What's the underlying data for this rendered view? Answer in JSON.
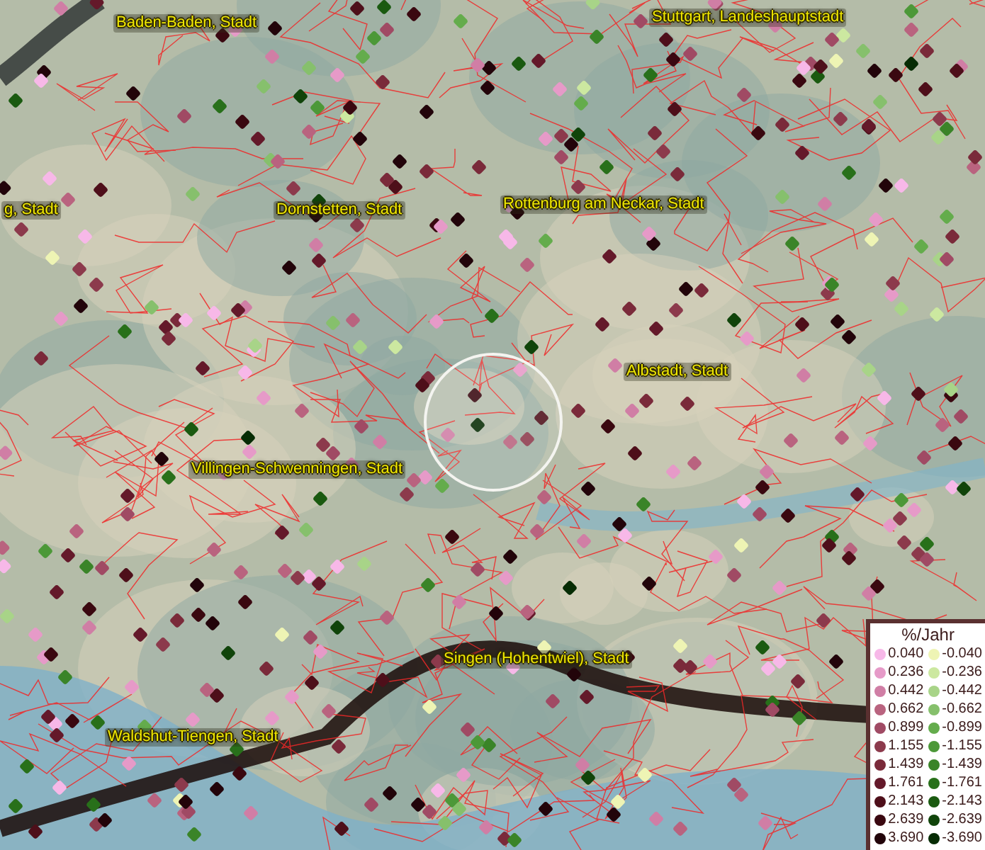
{
  "map": {
    "place_labels": [
      {
        "text": "Baden-Baden, Stadt"
      },
      {
        "text": "Stuttgart, Landeshauptstadt"
      },
      {
        "text": "g, Stadt"
      },
      {
        "text": "Dornstetten, Stadt"
      },
      {
        "text": "Rottenburg am Neckar, Stadt"
      },
      {
        "text": "Albstadt, Stadt"
      },
      {
        "text": "Villingen-Schwenningen, Stadt"
      },
      {
        "text": "Singen (Hohentwiel), Stadt"
      },
      {
        "text": "Waldshut-Tiengen, Stadt"
      }
    ]
  },
  "legend": {
    "title": "%/Jahr",
    "entries": [
      {
        "label": "0.040",
        "color": "#f7b8e8"
      },
      {
        "label": "-0.040",
        "color": "#eef4b4"
      },
      {
        "label": "0.236",
        "color": "#e69ac8"
      },
      {
        "label": "-0.236",
        "color": "#cce8a0"
      },
      {
        "label": "0.442",
        "color": "#d07ea5"
      },
      {
        "label": "-0.442",
        "color": "#a8d488"
      },
      {
        "label": "0.662",
        "color": "#b9637f"
      },
      {
        "label": "-0.662",
        "color": "#86c06c"
      },
      {
        "label": "0.899",
        "color": "#a04a64"
      },
      {
        "label": "-0.899",
        "color": "#64ac4c"
      },
      {
        "label": "1.155",
        "color": "#8c3a4c"
      },
      {
        "label": "-1.155",
        "color": "#4c9838"
      },
      {
        "label": "1.439",
        "color": "#7a2a3a"
      },
      {
        "label": "-1.439",
        "color": "#3a8428"
      },
      {
        "label": "1.761",
        "color": "#64192a"
      },
      {
        "label": "-1.761",
        "color": "#28701a"
      },
      {
        "label": "2.143",
        "color": "#4e0f1a"
      },
      {
        "label": "-2.143",
        "color": "#1a5a10"
      },
      {
        "label": "2.639",
        "color": "#3a0810"
      },
      {
        "label": "-2.639",
        "color": "#10440a"
      },
      {
        "label": "3.690",
        "color": "#22040a"
      },
      {
        "label": "-3.690",
        "color": "#062c04"
      }
    ]
  }
}
